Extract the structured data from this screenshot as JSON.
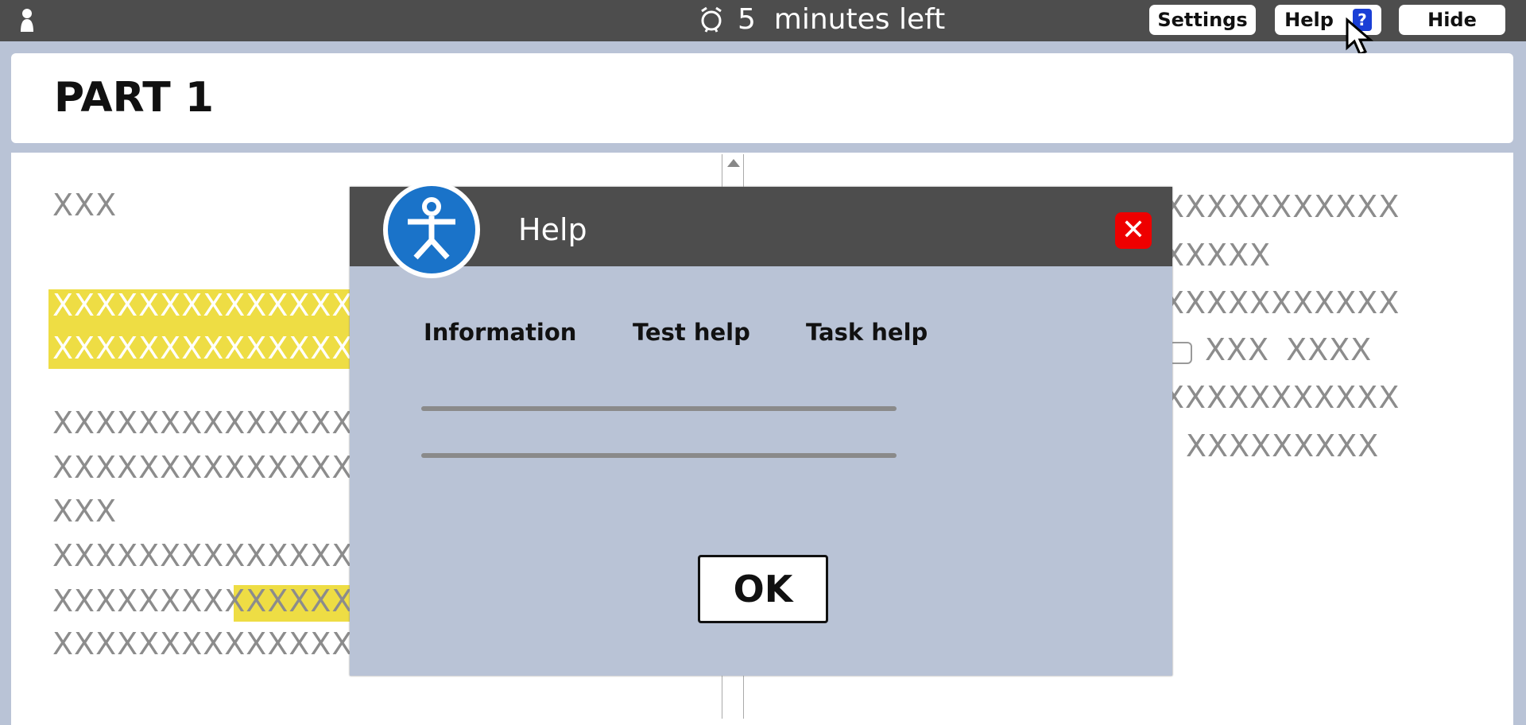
{
  "topbar": {
    "timer_icon": "alarm-clock-icon",
    "timer_text": "5  minutes left",
    "settings_label": "Settings",
    "help_label": "Help",
    "help_badge": "?",
    "hide_label": "Hide"
  },
  "header": {
    "title": "PART 1"
  },
  "left_text": [
    "XXX",
    "XXXXXXXXXXXXXXX",
    "XXXXXXXXXXXXXXX",
    "XXXXXXXXXXXXXXX",
    "XXXXXXXXXXXXXXX",
    "XXX",
    "XXXXXXXXXXXXXXX",
    "XXXXXXXXXXXXXXX",
    "XXXXXXXXXXXXXXX"
  ],
  "right_text": [
    "XXXXXXXXXXX",
    "XXXXX",
    "XXXXXXXXXXX",
    "XXX XXXX",
    "XXXXXXXXXXX",
    "XXXXXXXXX"
  ],
  "dialog": {
    "title": "Help",
    "tabs": [
      "Information",
      "Test help",
      "Task help"
    ],
    "ok_label": "OK",
    "colors": {
      "titlebar": "#4d4d4d",
      "body": "#b9c3d6",
      "close": "#ee0000",
      "icon": "#1a73c9"
    }
  },
  "colors": {
    "highlight": "#eedd44",
    "placeholder_text": "#8c8c8c"
  }
}
